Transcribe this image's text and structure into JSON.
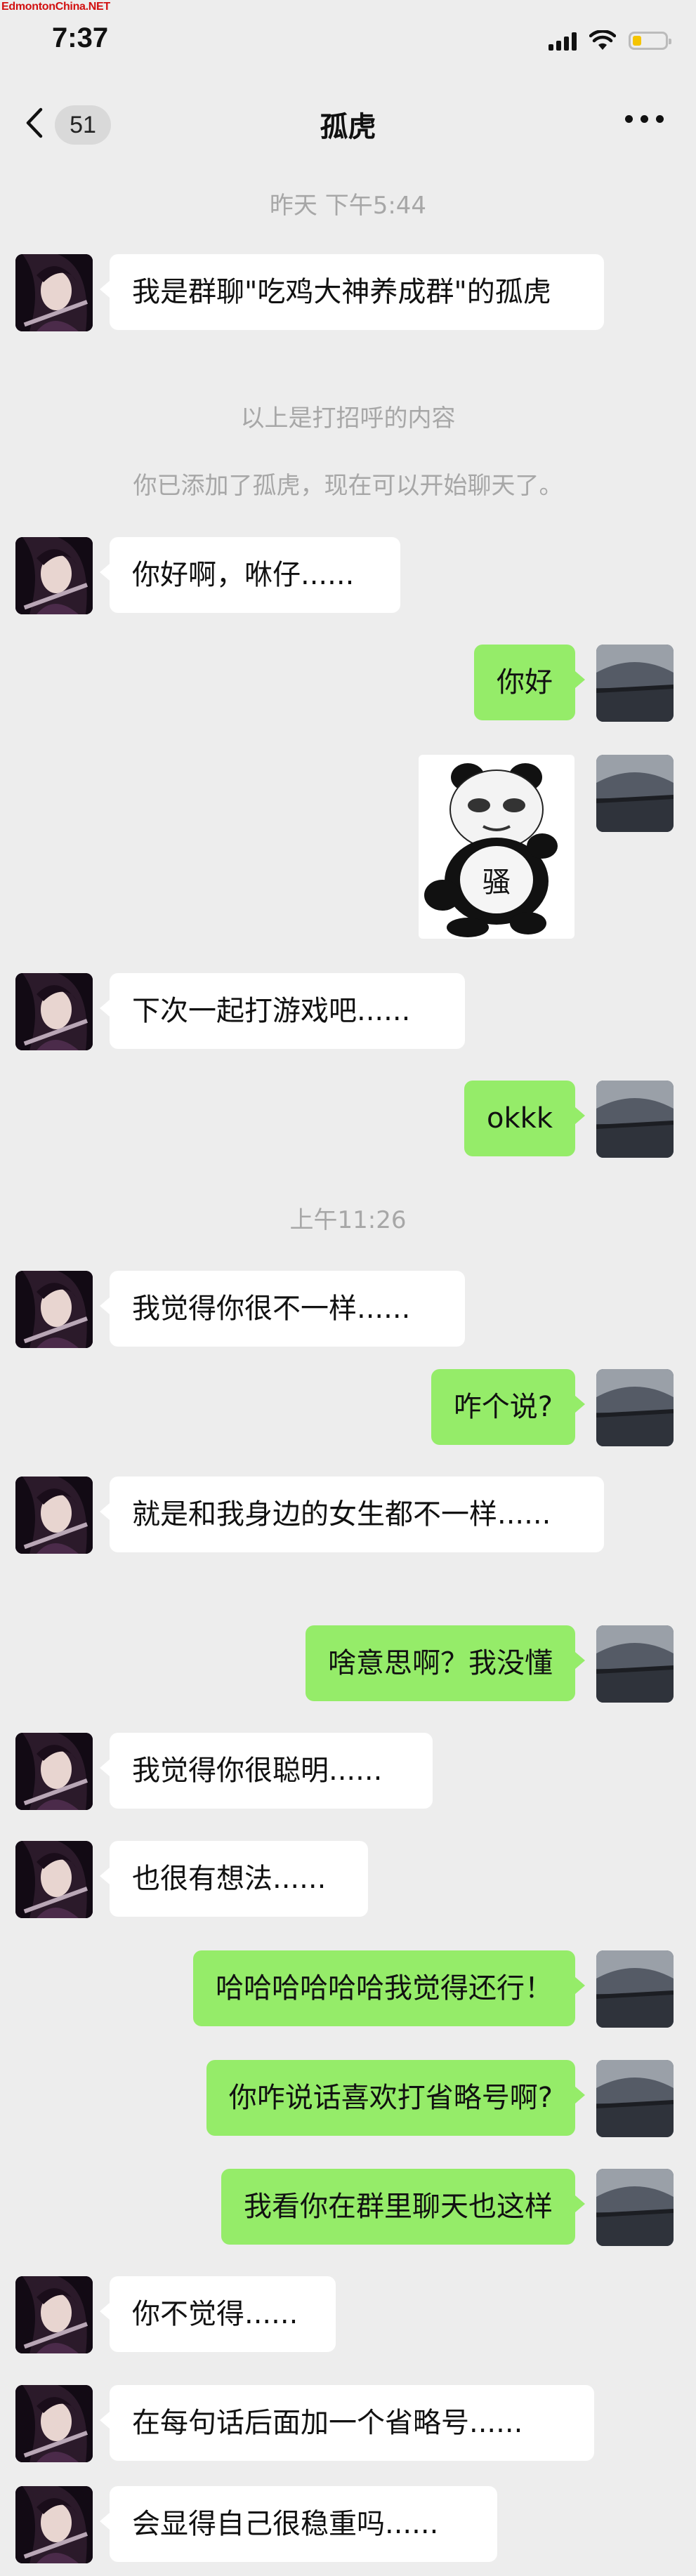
{
  "watermark": "EdmontonChina.NET",
  "status": {
    "time": "7:37"
  },
  "header": {
    "unread": "51",
    "title": "孤虎"
  },
  "colors": {
    "background": "#ededed",
    "outgoing_bubble": "#95ec69",
    "incoming_bubble": "#ffffff",
    "timestamp": "#a7a7a7"
  },
  "icons": {
    "back": "chevron-left-icon",
    "more": "more-dots-icon",
    "signal": "signal-icon",
    "wifi": "wifi-icon",
    "battery": "battery-icon"
  },
  "messages": [
    {
      "kind": "time",
      "text": "昨天 下午5:44"
    },
    {
      "kind": "in",
      "text": "我是群聊\"吃鸡大神养成群\"的孤虎"
    },
    {
      "kind": "system",
      "text": "以上是打招呼的内容"
    },
    {
      "kind": "system",
      "text": "你已添加了孤虎，现在可以开始聊天了。"
    },
    {
      "kind": "in",
      "text": "你好啊，咻仔......"
    },
    {
      "kind": "out",
      "text": "你好"
    },
    {
      "kind": "out_sticker",
      "text": "骚"
    },
    {
      "kind": "in",
      "text": "下次一起打游戏吧......"
    },
    {
      "kind": "out",
      "text": "okkk"
    },
    {
      "kind": "time",
      "text": "上午11:26"
    },
    {
      "kind": "in",
      "text": "我觉得你很不一样......"
    },
    {
      "kind": "out",
      "text": "咋个说?"
    },
    {
      "kind": "in",
      "text": "就是和我身边的女生都不一样......"
    },
    {
      "kind": "out",
      "text": "啥意思啊？我没懂"
    },
    {
      "kind": "in",
      "text": "我觉得你很聪明......"
    },
    {
      "kind": "in",
      "text": "也很有想法......"
    },
    {
      "kind": "out",
      "text": "哈哈哈哈哈哈我觉得还行！"
    },
    {
      "kind": "out",
      "text": "你咋说话喜欢打省略号啊?"
    },
    {
      "kind": "out",
      "text": "我看你在群里聊天也这样"
    },
    {
      "kind": "in",
      "text": "你不觉得......"
    },
    {
      "kind": "in",
      "text": "在每句话后面加一个省略号......"
    },
    {
      "kind": "in",
      "text": "会显得自己很稳重吗......"
    }
  ]
}
